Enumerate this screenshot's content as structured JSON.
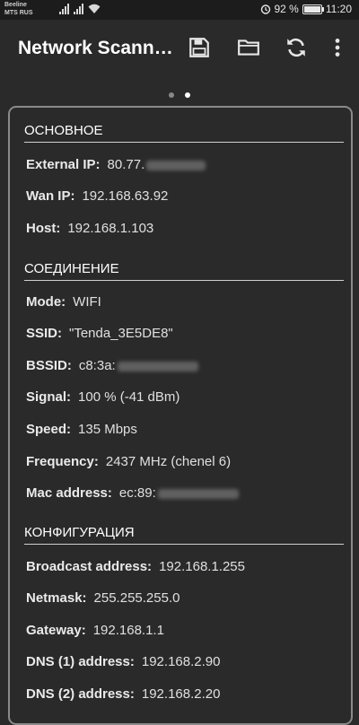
{
  "status_bar": {
    "carrier_1": "Beeline",
    "carrier_2": "MTS RUS",
    "battery_percent": "92 %",
    "time": "11:20"
  },
  "toolbar": {
    "title": "Network Scann…",
    "icons": [
      "save-icon",
      "folder-icon",
      "refresh-icon",
      "more-vert-icon"
    ]
  },
  "pager": {
    "pages": 2,
    "active": 2
  },
  "sections": {
    "basic": {
      "title": "ОСНОВНОЕ",
      "external_ip_label": "External IP:",
      "external_ip_value": "80.77.",
      "wan_ip_label": "Wan IP:",
      "wan_ip_value": "192.168.63.92",
      "host_label": "Host:",
      "host_value": "192.168.1.103"
    },
    "connection": {
      "title": "СОЕДИНЕНИЕ",
      "mode_label": "Mode:",
      "mode_value": "WIFI",
      "ssid_label": "SSID:",
      "ssid_value": "\"Tenda_3E5DE8\"",
      "bssid_label": "BSSID:",
      "bssid_value": "c8:3a:",
      "signal_label": "Signal:",
      "signal_value": "100 % (-41 dBm)",
      "speed_label": "Speed:",
      "speed_value": "135 Mbps",
      "frequency_label": "Frequency:",
      "frequency_value": "2437 MHz (chenel 6)",
      "mac_label": "Mac address:",
      "mac_value": "ec:89:"
    },
    "config": {
      "title": "КОНФИГУРАЦИЯ",
      "broadcast_label": "Broadcast address:",
      "broadcast_value": "192.168.1.255",
      "netmask_label": "Netmask:",
      "netmask_value": "255.255.255.0",
      "gateway_label": "Gateway:",
      "gateway_value": "192.168.1.1",
      "dns1_label": "DNS (1) address:",
      "dns1_value": "192.168.2.90",
      "dns2_label": "DNS (2) address:",
      "dns2_value": "192.168.2.20"
    }
  },
  "colors": {
    "background": "#2a2a2a",
    "card_border": "#8a8a8a",
    "text": "#e0e0e0",
    "title": "#ffffff"
  }
}
